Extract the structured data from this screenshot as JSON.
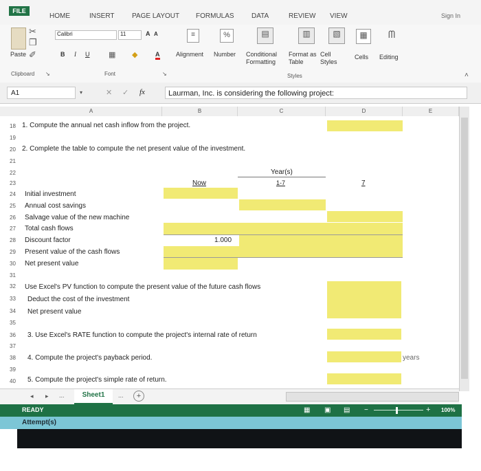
{
  "ribbon": {
    "file_tab": "FILE",
    "tabs": [
      "HOME",
      "INSERT",
      "PAGE LAYOUT",
      "FORMULAS",
      "DATA",
      "REVIEW",
      "VIEW"
    ],
    "sign_in": "Sign In",
    "paste": "Paste",
    "font_name": "Calibri",
    "font_size": "11",
    "bold": "B",
    "italic": "I",
    "underline": "U",
    "grow_font": "A",
    "shrink_font": "A",
    "font_color_glyph": "A",
    "alignment": "Alignment",
    "number": "Number",
    "percent_glyph": "%",
    "conditional_formatting": "Conditional Formatting",
    "format_as_table": "Format as Table",
    "cell_styles": "Cell Styles",
    "cells": "Cells",
    "editing": "Editing",
    "groups": {
      "clipboard": "Clipboard",
      "font": "Font",
      "styles": "Styles"
    }
  },
  "formula_bar": {
    "name_box": "A1",
    "fx": "fx",
    "cancel_glyph": "✕",
    "enter_glyph": "✓",
    "content": "Laurman, Inc. is considering the following project:"
  },
  "columns": [
    "A",
    "B",
    "C",
    "D",
    "E"
  ],
  "rows": {
    "r18": "1. Compute the annual net cash inflow from the project.",
    "r20": "2. Complete the table to compute the net present value of the investment.",
    "years_header": "Year(s)",
    "now": "Now",
    "years_range": "1-7",
    "year7": "7",
    "r24": "Initial investment",
    "r25": "Annual cost savings",
    "r26": "Salvage value of the new machine",
    "r27": "Total cash flows",
    "r28": "Discount factor",
    "discount_now": "1.000",
    "r29": "Present value of the cash flows",
    "r30": "Net present value",
    "r32": "Use Excel's PV function to compute the present value of the future cash flows",
    "r33": "Deduct the cost of the investment",
    "r34": "Net present value",
    "r36": "3. Use Excel's RATE function to compute the project's internal rate of return",
    "r38": "4. Compute the project's payback period.",
    "years_label": "years",
    "r40": "5. Compute the project's simple rate of return."
  },
  "row_numbers": [
    "18",
    "19",
    "20",
    "21",
    "22",
    "23",
    "24",
    "25",
    "26",
    "27",
    "28",
    "29",
    "30",
    "31",
    "32",
    "33",
    "34",
    "35",
    "36",
    "37",
    "38",
    "39",
    "40"
  ],
  "sheet_tabs": {
    "sheet1": "Sheet1",
    "ellipsis": "...",
    "ellipsis2": "..."
  },
  "status": {
    "ready": "READY",
    "zoom": "100%",
    "attempts": "Attempt(s)"
  },
  "colors": {
    "accent_green": "#217346",
    "highlight_yellow": "#f1ea74"
  }
}
